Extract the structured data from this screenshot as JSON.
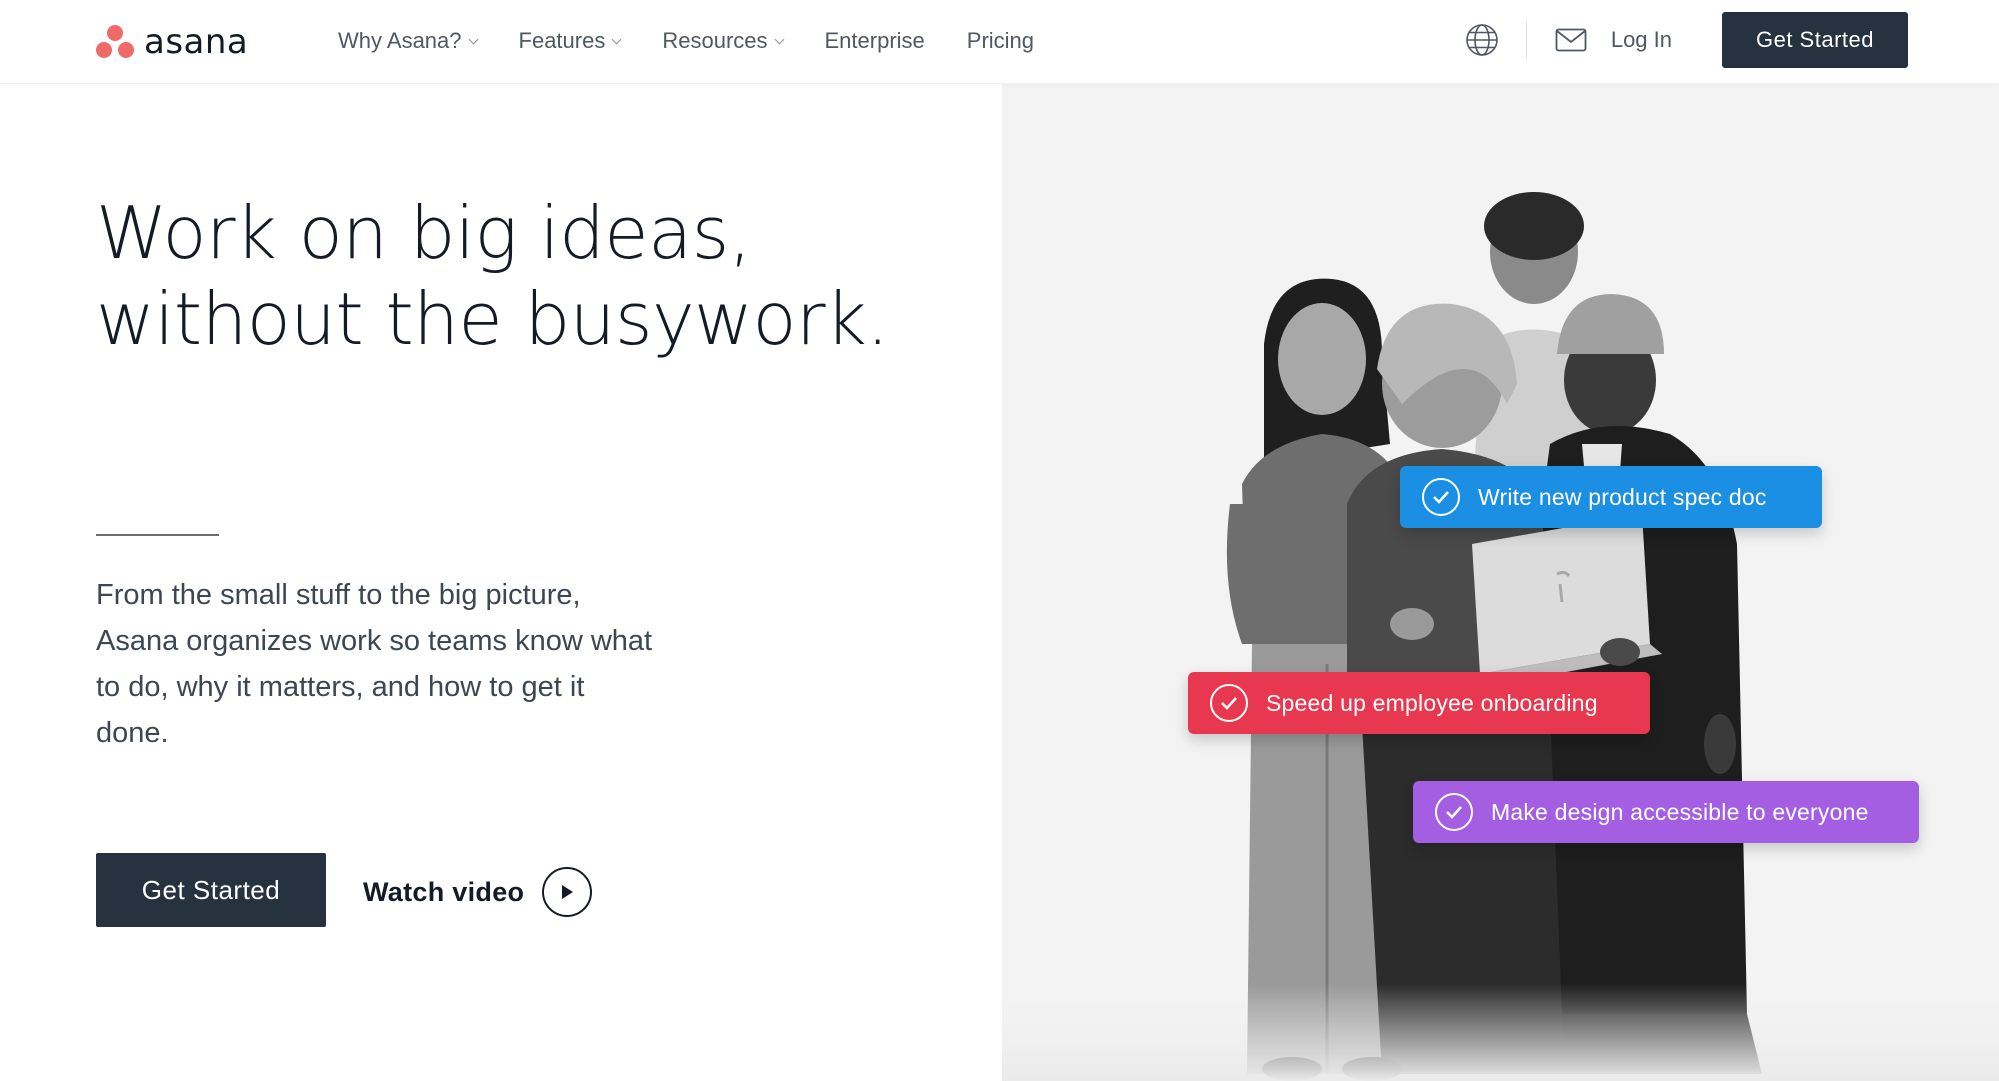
{
  "brand": {
    "name": "asana",
    "logo_color": "#f06a6a"
  },
  "nav": {
    "items": [
      {
        "label": "Why Asana?",
        "has_dropdown": true
      },
      {
        "label": "Features",
        "has_dropdown": true
      },
      {
        "label": "Resources",
        "has_dropdown": true
      },
      {
        "label": "Enterprise",
        "has_dropdown": false
      },
      {
        "label": "Pricing",
        "has_dropdown": false
      }
    ],
    "login_label": "Log In",
    "cta_label": "Get Started",
    "icons": [
      "globe-icon",
      "mail-icon"
    ]
  },
  "hero": {
    "headline_line1": "Work on big ideas,",
    "headline_line2": "without the busywork.",
    "description": "From the small stuff to the big picture, Asana organizes work so teams know what to do, why it matters, and how to get it done.",
    "cta_label": "Get Started",
    "video_label": "Watch video"
  },
  "tasks": [
    {
      "label": "Write new product spec doc",
      "color": "#1a8fe3"
    },
    {
      "label": "Speed up employee onboarding",
      "color": "#e8384f"
    },
    {
      "label": "Make design accessible to everyone",
      "color": "#a35ee2"
    }
  ],
  "colors": {
    "primary_dark": "#273240",
    "text_dark": "#151b26",
    "right_panel_bg": "#f3f3f4"
  }
}
